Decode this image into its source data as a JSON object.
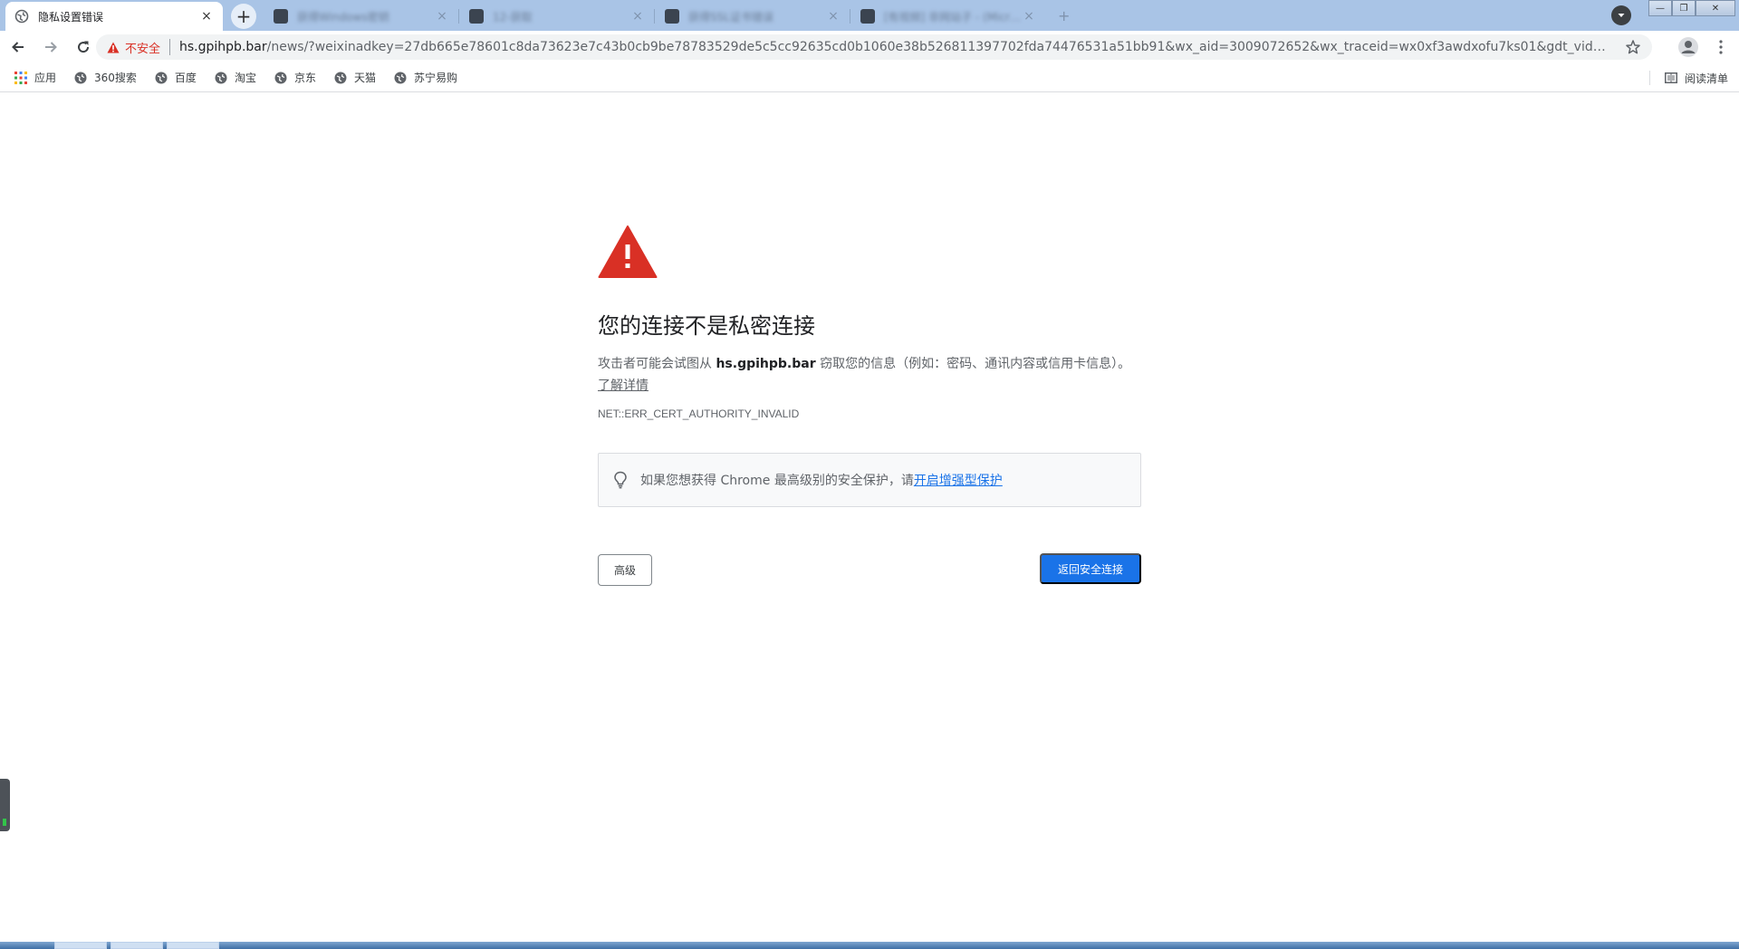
{
  "browser": {
    "active_tab": {
      "title": "隐私设置错误",
      "close": "×"
    },
    "inactive_tabs": [
      {
        "title": "获得Windows密钥"
      },
      {
        "title": "12-获取"
      },
      {
        "title": "获得SSL证书错误"
      },
      {
        "title": "[有视频] 非网站子 - (Micr…"
      }
    ],
    "new_tab": "+",
    "window_controls": {
      "minimize": "—",
      "restore": "❐",
      "close": "✕"
    }
  },
  "toolbar": {
    "security_label": "不安全",
    "url_host": "hs.gpihpb.bar",
    "url_rest": "/news/?weixinadkey=27db665e78601c8da73623e7c43b0cb9be78783529de5c5cc92635cd0b1060e38b526811397702fda74476531a51bb91&wx_aid=3009072652&wx_traceid=wx0xf3awdxofu7ks01&gdt_vid=wx0xf3awdxofu7..."
  },
  "bookmarks": {
    "items": [
      {
        "label": "应用",
        "icon": "apps-grid-icon"
      },
      {
        "label": "360搜索",
        "icon": "globe-icon"
      },
      {
        "label": "百度",
        "icon": "globe-icon"
      },
      {
        "label": "淘宝",
        "icon": "globe-icon"
      },
      {
        "label": "京东",
        "icon": "globe-icon"
      },
      {
        "label": "天猫",
        "icon": "globe-icon"
      },
      {
        "label": "苏宁易购",
        "icon": "globe-icon"
      }
    ],
    "reading_list": "阅读清单"
  },
  "interstitial": {
    "heading": "您的连接不是私密连接",
    "desc_prefix": "攻击者可能会试图从 ",
    "desc_host": "hs.gpihpb.bar",
    "desc_suffix": " 窃取您的信息（例如：密码、通讯内容或信用卡信息）。",
    "learn_more": "了解详情",
    "error_code": "NET::ERR_CERT_AUTHORITY_INVALID",
    "enhanced_text": "如果您想获得 Chrome 最高级别的安全保护，请",
    "enhanced_link": "开启增强型保护",
    "advanced_button": "高级",
    "back_button": "返回安全连接"
  },
  "colors": {
    "tabstrip": "#a9c4e6",
    "warning_red": "#d93025",
    "primary_blue": "#1a73e8"
  }
}
